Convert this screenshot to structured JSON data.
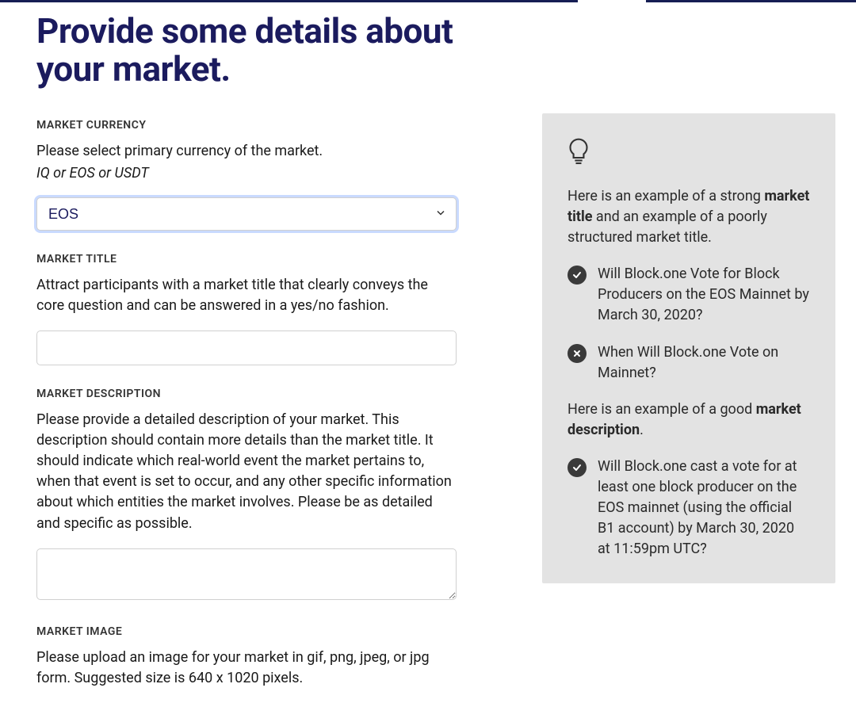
{
  "heading": "Provide some details about your market.",
  "sections": {
    "currency": {
      "label": "MARKET CURRENCY",
      "desc": "Please select primary currency of the market.",
      "hint": "IQ or EOS or USDT",
      "selected": "EOS"
    },
    "title": {
      "label": "MARKET TITLE",
      "desc": "Attract participants with a market title that clearly conveys the core question and can be answered in a yes/no fashion.",
      "value": ""
    },
    "description": {
      "label": "MARKET DESCRIPTION",
      "desc": "Please provide a detailed description of your market. This description should contain more details than the market title. It should indicate which real-world event the market pertains to, when that event is set to occur, and any other specific information about which entities the market involves. Please be as detailed and specific as possible.",
      "value": ""
    },
    "image": {
      "label": "MARKET IMAGE",
      "desc": "Please upload an image for your market in gif, png, jpeg, or jpg form. Suggested size is 640 x 1020 pixels."
    }
  },
  "info": {
    "intro_before": "Here is an example of a strong ",
    "intro_strong": "market title",
    "intro_after": " and an example of a poorly structured market title.",
    "example_good": "Will Block.one Vote for Block Producers on the EOS Mainnet by March 30, 2020?",
    "example_bad": "When Will Block.one Vote on Mainnet?",
    "desc_intro_before": "Here is an example of a good ",
    "desc_intro_strong": "market description",
    "desc_intro_after": ".",
    "desc_example": "Will Block.one cast a vote for at least one block producer on the EOS mainnet (using the official B1 account) by March 30, 2020 at 11:59pm UTC?"
  }
}
